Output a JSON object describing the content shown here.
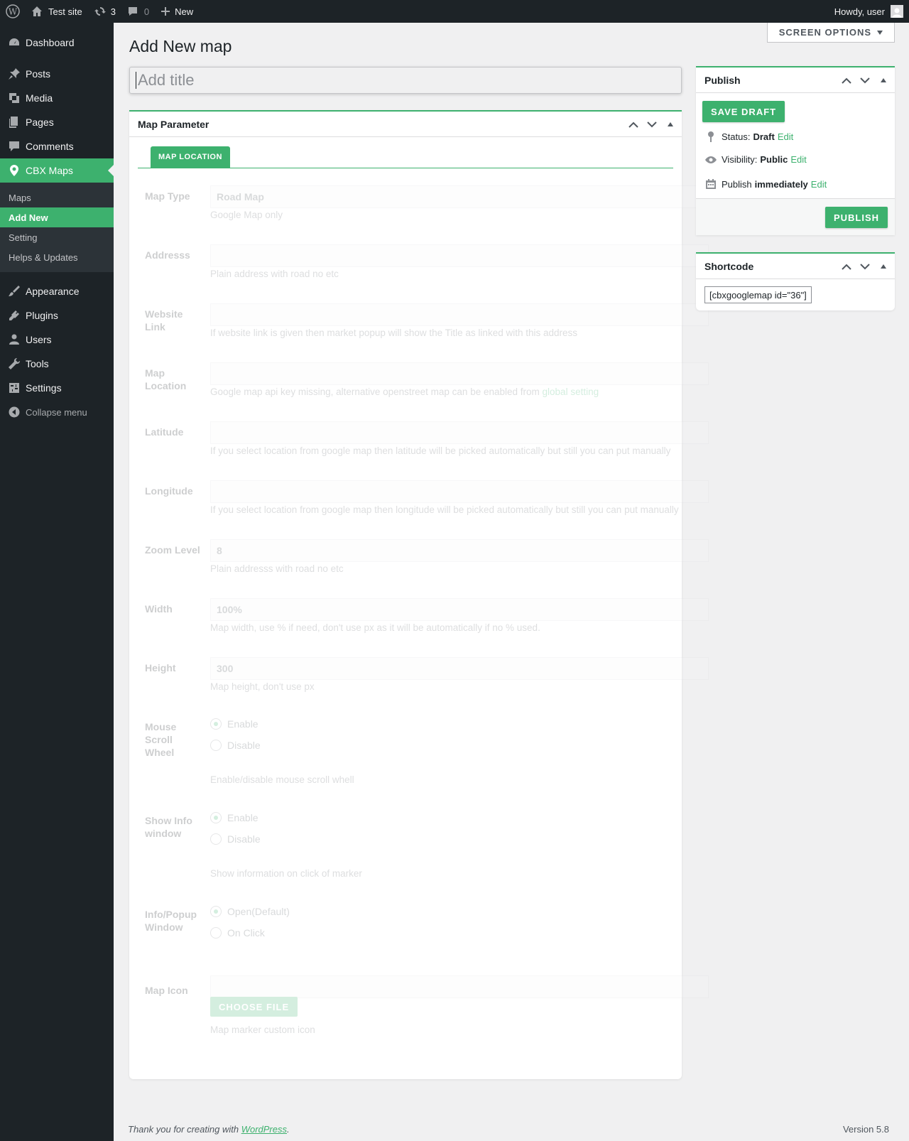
{
  "admin_bar": {
    "site_name": "Test site",
    "updates_count": "3",
    "comments_count": "0",
    "new_label": "New",
    "howdy": "Howdy, user"
  },
  "sidebar": {
    "items": [
      {
        "label": "Dashboard",
        "icon": "dashboard-icon"
      },
      {
        "label": "Posts",
        "icon": "pin-icon"
      },
      {
        "label": "Media",
        "icon": "media-icon"
      },
      {
        "label": "Pages",
        "icon": "pages-icon"
      },
      {
        "label": "Comments",
        "icon": "comment-icon"
      },
      {
        "label": "CBX Maps",
        "icon": "location-icon"
      }
    ],
    "submenu": [
      "Maps",
      "Add New",
      "Setting",
      "Helps & Updates"
    ],
    "items2": [
      {
        "label": "Appearance",
        "icon": "brush-icon"
      },
      {
        "label": "Plugins",
        "icon": "plugin-icon"
      },
      {
        "label": "Users",
        "icon": "users-icon"
      },
      {
        "label": "Tools",
        "icon": "wrench-icon"
      },
      {
        "label": "Settings",
        "icon": "settings-icon"
      }
    ],
    "collapse": "Collapse menu"
  },
  "header": {
    "screen_options": "SCREEN OPTIONS",
    "title": "Add New map",
    "title_placeholder": "Add title"
  },
  "map_box": {
    "title": "Map Parameter",
    "tab": "MAP LOCATION",
    "fields": {
      "map_type": {
        "label": "Map Type",
        "value": "Road Map",
        "desc": "Google Map only"
      },
      "address": {
        "label": "Addresss",
        "value": "",
        "desc": "Plain address with road no etc"
      },
      "website": {
        "label": "Website Link",
        "value": "",
        "desc": "If website link is given then market popup will show the Title as linked with this address"
      },
      "location": {
        "label": "Map Location",
        "value": "",
        "desc": "Google map api key missing, alternative openstreet map can be enabled from",
        "link": "global setting"
      },
      "latitude": {
        "label": "Latitude",
        "value": "",
        "desc": "If you select location from google map then latitude will be picked automatically but still you can put manually"
      },
      "longitude": {
        "label": "Longitude",
        "value": "",
        "desc": "If you select location from google map then longitude will be picked automatically but still you can put manually"
      },
      "zoom": {
        "label": "Zoom Level",
        "value": "8",
        "desc": "Plain addresss with road no etc"
      },
      "width": {
        "label": "Width",
        "value": "100%",
        "desc": "Map width, use % if need, don't use px as it will be automatically if no % used."
      },
      "height": {
        "label": "Height",
        "value": "300",
        "desc": "Map height, don't use px"
      },
      "scroll": {
        "label": "Mouse Scroll Wheel",
        "opt1": "Enable",
        "opt2": "Disable",
        "desc": "Enable/disable mouse scroll whell"
      },
      "info": {
        "label": "Show Info window",
        "opt1": "Enable",
        "opt2": "Disable",
        "desc": "Show information on click of marker"
      },
      "popup": {
        "label": "Info/Popup Window",
        "opt1": "Open(Default)",
        "opt2": "On Click"
      },
      "icon": {
        "label": "Map Icon",
        "button": "CHOOSE FILE",
        "desc": "Map marker custom icon"
      }
    }
  },
  "publish": {
    "title": "Publish",
    "save_draft": "SAVE DRAFT",
    "status_label": "Status:",
    "status_value": "Draft",
    "visibility_label": "Visibility:",
    "visibility_value": "Public",
    "publish_label": "Publish",
    "publish_value": "immediately",
    "edit": "Edit",
    "publish_button": "PUBLISH"
  },
  "shortcode": {
    "title": "Shortcode",
    "value": "[cbxgooglemap id=\"36\"]"
  },
  "footer": {
    "thanks": "Thank you for creating with",
    "wp_link": "WordPress",
    "period": ".",
    "version": "Version 5.8"
  },
  "colors": {
    "accent": "#3db16e",
    "admin_dark": "#1d2327"
  }
}
